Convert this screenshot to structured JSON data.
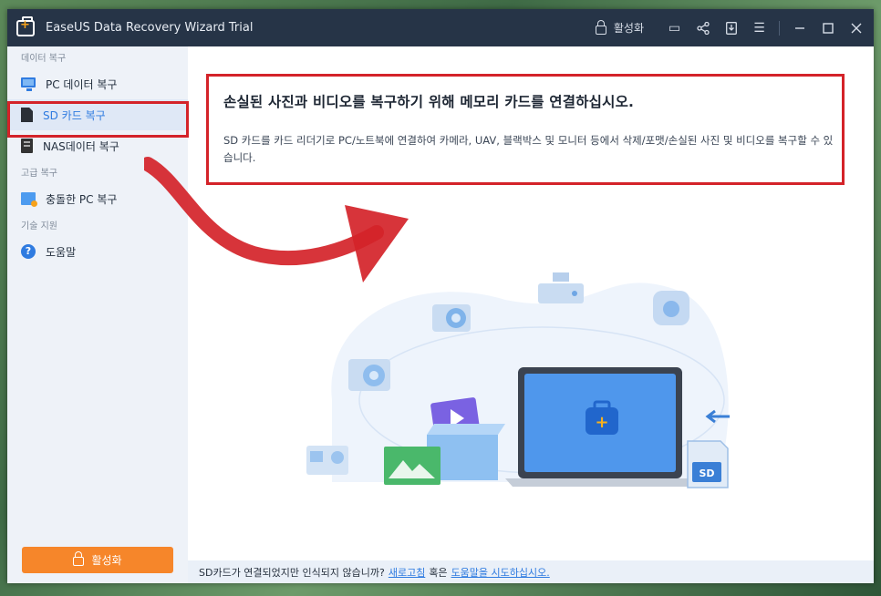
{
  "window": {
    "title": "EaseUS Data Recovery Wizard Trial",
    "activate_label": "활성화",
    "icons": [
      "feedback-icon",
      "share-icon",
      "download-icon",
      "menu-icon",
      "minimize-icon",
      "maximize-icon",
      "close-icon"
    ]
  },
  "sidebar": {
    "section1": "데이터 복구",
    "section2": "고급 복구",
    "section3": "기술 지원",
    "items": [
      {
        "label": "PC 데이터 복구",
        "icon": "monitor-icon"
      },
      {
        "label": "SD 카드 복구",
        "icon": "sd-card-icon"
      },
      {
        "label": "NAS데이터 복구",
        "icon": "nas-icon"
      },
      {
        "label": "충돌한 PC 복구",
        "icon": "crashed-pc-icon"
      },
      {
        "label": "도움말",
        "icon": "help-icon"
      }
    ],
    "activate_button": "활성화",
    "help_glyph": "?"
  },
  "main": {
    "headline": "손실된 사진과 비디오를 복구하기 위해 메모리 카드를 연결하십시오.",
    "description": "SD 카드를 카드 리더기로 PC/노트북에 연결하여 카메라, UAV, 블랙박스 및 모니터 등에서 삭제/포맷/손실된 사진 및 비디오를 복구할 수 있습니다.",
    "sd_label": "SD"
  },
  "footer": {
    "prefix": "SD카드가 연결되었지만 인식되지 않습니까?",
    "refresh_link": "새로고침",
    "middle": "혹은",
    "help_link": "도움말을 시도하십시오."
  },
  "colors": {
    "titlebar": "#263447",
    "sidebar": "#eef2f8",
    "accent": "#2f7be0",
    "activate": "#f6862a",
    "annotation": "#d42329"
  }
}
